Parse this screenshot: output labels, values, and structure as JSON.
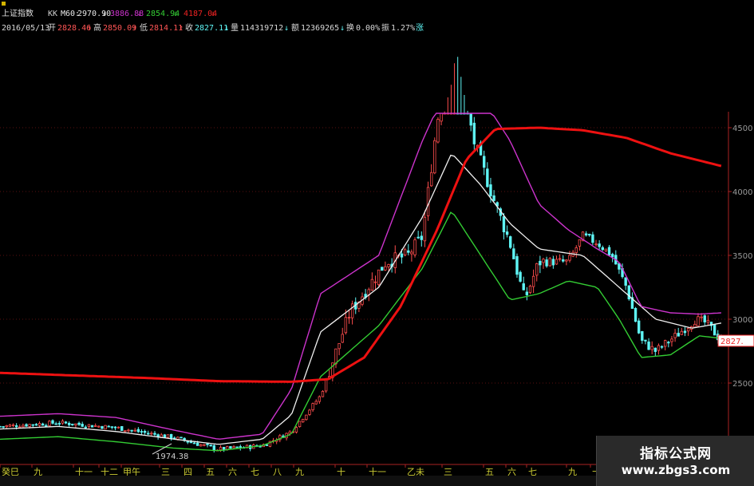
{
  "header": {
    "title": "上证指数",
    "ma_label": "KK",
    "m60_label": "M60:",
    "m60_value": "2970.90",
    "m60_arrow": "↓",
    "band_upper": "3886.88",
    "band_upper_arrow": "↓",
    "band_lower": "2854.94",
    "band_lower_arrow": "↓",
    "ma_long": "4187.04",
    "ma_long_arrow": "↓",
    "date": "2016/05/13",
    "open_label": "开",
    "open": "2828.46",
    "open_arrow": "↑",
    "high_label": "高",
    "high": "2850.09",
    "high_arrow": "↑",
    "low_label": "低",
    "low": "2814.11",
    "low_arrow": "↑",
    "close_label": "收",
    "close": "2827.11",
    "close_arrow": "↓",
    "vol_label": "量",
    "volume": "114319712",
    "volume_arrow": "↓",
    "amount_label": "额",
    "amount": "12369265",
    "amount_arrow": "↓",
    "turnover_label": "换",
    "turnover": "0.00%",
    "amplitude_label": "振",
    "amplitude": "1.27%",
    "change_label": "涨"
  },
  "price_tag": "2827.",
  "watermark": {
    "title": "指标公式网",
    "url": "www.zbgs3.com"
  },
  "colors": {
    "candle_up": "#ff4d4d",
    "candle_down": "#5ff5f5",
    "ma60": "#f0f0f0",
    "upper_band": "#cc33cc",
    "lower_band": "#33cc33",
    "long_ma": "#ee1111",
    "axis": "#aa2222",
    "tick_text": "#9a9a9a",
    "x_text": "#cccc33"
  },
  "chart_data": {
    "type": "line",
    "title": "上证指数",
    "xlabel": "",
    "ylabel": "",
    "ylim": [
      2000,
      4800
    ],
    "grid": true,
    "y_ticks": [
      "4500",
      "4000",
      "3500",
      "3000",
      "2500"
    ],
    "y_tick_values": [
      4500,
      4000,
      3500,
      3000,
      2500
    ],
    "x_ticks": [
      "癸巳",
      "九",
      "十一",
      "十二",
      "甲午",
      "三",
      "四",
      "五",
      "六",
      "七",
      "八",
      "九",
      "十",
      "十一",
      "乙未",
      "三",
      "五",
      "六",
      "七",
      "九",
      "十"
    ],
    "annotations": [
      {
        "label": "1974.38",
        "value": 1974.38
      }
    ],
    "series": [
      {
        "name": "",
        "values": [
          [
            0,
            2160
          ],
          [
            0.08,
            2190
          ],
          [
            0.16,
            2150
          ],
          [
            0.24,
            2070
          ],
          [
            0.3,
            1980
          ],
          [
            0.36,
            2010
          ],
          [
            0.4,
            2120
          ],
          [
            0.44,
            2400
          ],
          [
            0.48,
            3050
          ],
          [
            0.53,
            3450
          ],
          [
            0.56,
            3500
          ],
          [
            0.58,
            3650
          ],
          [
            0.6,
            4550
          ],
          [
            0.625,
            5180
          ],
          [
            0.65,
            4400
          ],
          [
            0.68,
            3900
          ],
          [
            0.7,
            3600
          ],
          [
            0.72,
            3150
          ],
          [
            0.74,
            3450
          ],
          [
            0.78,
            3450
          ],
          [
            0.8,
            3650
          ],
          [
            0.82,
            3600
          ],
          [
            0.84,
            3500
          ],
          [
            0.86,
            3250
          ],
          [
            0.88,
            2830
          ],
          [
            0.9,
            2750
          ],
          [
            0.93,
            2880
          ],
          [
            0.955,
            3000
          ],
          [
            0.97,
            2970
          ],
          [
            0.99,
            2830
          ]
        ]
      },
      {
        "name": "M60",
        "values": [
          [
            0,
            2140
          ],
          [
            0.08,
            2160
          ],
          [
            0.16,
            2120
          ],
          [
            0.24,
            2060
          ],
          [
            0.3,
            2020
          ],
          [
            0.36,
            2060
          ],
          [
            0.4,
            2250
          ],
          [
            0.44,
            2900
          ],
          [
            0.52,
            3250
          ],
          [
            0.58,
            3800
          ],
          [
            0.62,
            4300
          ],
          [
            0.66,
            4050
          ],
          [
            0.7,
            3750
          ],
          [
            0.74,
            3550
          ],
          [
            0.8,
            3500
          ],
          [
            0.85,
            3250
          ],
          [
            0.9,
            3000
          ],
          [
            0.95,
            2930
          ],
          [
            0.99,
            2970
          ]
        ]
      },
      {
        "name": "",
        "values": [
          [
            0,
            2240
          ],
          [
            0.08,
            2260
          ],
          [
            0.16,
            2230
          ],
          [
            0.24,
            2130
          ],
          [
            0.3,
            2060
          ],
          [
            0.36,
            2100
          ],
          [
            0.4,
            2450
          ],
          [
            0.44,
            3200
          ],
          [
            0.52,
            3500
          ],
          [
            0.58,
            4400
          ],
          [
            0.62,
            4900
          ],
          [
            0.66,
            4750
          ],
          [
            0.7,
            4400
          ],
          [
            0.74,
            3900
          ],
          [
            0.78,
            3700
          ],
          [
            0.82,
            3550
          ],
          [
            0.85,
            3450
          ],
          [
            0.88,
            3100
          ],
          [
            0.92,
            3050
          ],
          [
            0.96,
            3040
          ],
          [
            0.99,
            3050
          ]
        ]
      },
      {
        "name": "",
        "values": [
          [
            0,
            2060
          ],
          [
            0.08,
            2080
          ],
          [
            0.16,
            2040
          ],
          [
            0.24,
            1990
          ],
          [
            0.3,
            1970
          ],
          [
            0.36,
            2010
          ],
          [
            0.4,
            2100
          ],
          [
            0.44,
            2550
          ],
          [
            0.52,
            2950
          ],
          [
            0.58,
            3400
          ],
          [
            0.62,
            3850
          ],
          [
            0.66,
            3500
          ],
          [
            0.7,
            3150
          ],
          [
            0.74,
            3200
          ],
          [
            0.78,
            3300
          ],
          [
            0.82,
            3250
          ],
          [
            0.85,
            3000
          ],
          [
            0.88,
            2700
          ],
          [
            0.92,
            2720
          ],
          [
            0.96,
            2870
          ],
          [
            0.99,
            2850
          ]
        ]
      },
      {
        "name": "",
        "values": [
          [
            0,
            2580
          ],
          [
            0.1,
            2560
          ],
          [
            0.2,
            2540
          ],
          [
            0.3,
            2515
          ],
          [
            0.4,
            2510
          ],
          [
            0.45,
            2530
          ],
          [
            0.5,
            2700
          ],
          [
            0.55,
            3100
          ],
          [
            0.6,
            3700
          ],
          [
            0.64,
            4250
          ],
          [
            0.68,
            4490
          ],
          [
            0.74,
            4500
          ],
          [
            0.8,
            4480
          ],
          [
            0.86,
            4420
          ],
          [
            0.92,
            4300
          ],
          [
            0.99,
            4200
          ]
        ]
      }
    ]
  }
}
